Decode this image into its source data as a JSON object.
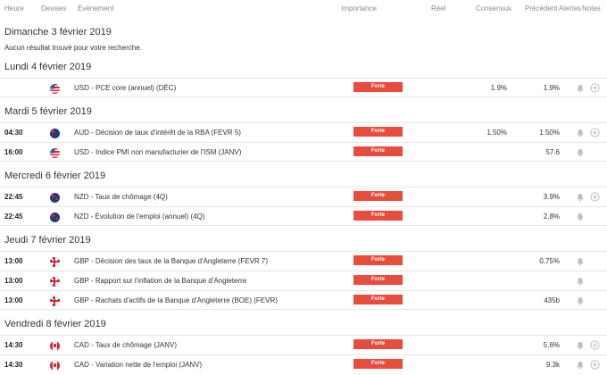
{
  "columns": {
    "time": "Heure",
    "currency": "Devises",
    "event": "Évènement",
    "importance": "Importance",
    "actual": "Réel",
    "consensus": "Consensus",
    "previous": "Précédent",
    "alerts": "Alertes",
    "notes": "Notes"
  },
  "colors": {
    "importance_strong": "#e74c3c",
    "row_border": "#e6e6e6"
  },
  "days": [
    {
      "title": "Dimanche 3 février 2019",
      "message": "Aucun résultat trouvé pour votre recherche."
    },
    {
      "title": "Lundi 4 février 2019"
    },
    {
      "title": "Mardi 5 février 2019"
    },
    {
      "title": "Mercredi 6 février 2019"
    },
    {
      "title": "Jeudi 7 février 2019"
    },
    {
      "title": "Vendredi 8 février 2019"
    }
  ],
  "events": [
    {
      "time": "",
      "flag": "us-flag-icon",
      "event": "USD - PCE core (annuel) (DÉC)",
      "importance": "Forte",
      "consensus": "1.9%",
      "previous": "1.9%",
      "alert_icon": "bell-icon",
      "note_icon": "add-note-icon"
    },
    {
      "time": "04:30",
      "flag": "au-flag-icon",
      "event": "AUD - Décision de taux d'intérêt de la RBA (FEVR 5)",
      "importance": "Forte",
      "consensus": "1.50%",
      "previous": "1.50%",
      "alert_icon": "bell-icon",
      "note_icon": "add-note-icon"
    },
    {
      "time": "16:00",
      "flag": "us-flag-icon",
      "event": "USD - Indice PMI non manufacturier de l'ISM (JANV)",
      "importance": "Forte",
      "consensus": "",
      "previous": "57.6",
      "alert_icon": "bell-icon"
    },
    {
      "time": "22:45",
      "flag": "nz-flag-icon",
      "event": "NZD - Taux de chômage (4Q)",
      "importance": "Forte",
      "consensus": "",
      "previous": "3.9%",
      "alert_icon": "bell-icon",
      "note_icon": "add-note-icon"
    },
    {
      "time": "22:45",
      "flag": "nz-flag-icon",
      "event": "NZD - Évolution de l'emploi (annuel) (4Q)",
      "importance": "Forte",
      "consensus": "",
      "previous": "2.8%",
      "alert_icon": "bell-icon"
    },
    {
      "time": "13:00",
      "flag": "gb-flag-icon",
      "event": "GBP - Décision des taux de la Banque d'Angleterre (FEVR 7)",
      "importance": "Forte",
      "consensus": "",
      "previous": "0.75%",
      "alert_icon": "bell-icon"
    },
    {
      "time": "13:00",
      "flag": "gb-flag-icon",
      "event": "GBP - Rapport sur l'inflation de la Banque d'Angleterre",
      "importance": "Forte",
      "consensus": "",
      "previous": "",
      "alert_icon": "bell-icon"
    },
    {
      "time": "13:00",
      "flag": "gb-flag-icon",
      "event": "GBP - Rachats d'actifs de la Banque d'Angleterre (BOE) (FEVR)",
      "importance": "Forte",
      "consensus": "",
      "previous": "435b",
      "alert_icon": "bell-icon"
    },
    {
      "time": "14:30",
      "flag": "ca-flag-icon",
      "event": "CAD - Taux de chômage (JANV)",
      "importance": "Forte",
      "consensus": "",
      "previous": "5.6%",
      "alert_icon": "bell-icon",
      "note_icon": "add-note-icon"
    },
    {
      "time": "14:30",
      "flag": "ca-flag-icon",
      "event": "CAD - Variation nette de l'emploi (JANV)",
      "importance": "Forte",
      "consensus": "",
      "previous": "9.3k",
      "alert_icon": "bell-icon",
      "note_icon": "add-note-icon"
    }
  ]
}
